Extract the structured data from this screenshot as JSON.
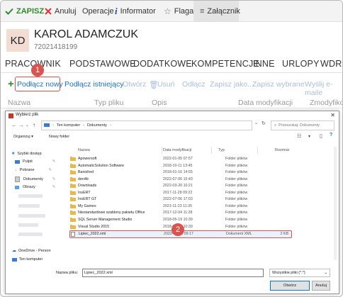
{
  "toolbar": {
    "save_label": "ZAPISZ",
    "cancel_label": "Anuluj",
    "operations_label": "Operacje",
    "informator_label": "Informator",
    "flag_label": "Flaga",
    "attachment_label": "Załącznik"
  },
  "header": {
    "initials": "KD",
    "name": "KAROL ADAMCZUK",
    "id": "72021418199"
  },
  "tabs": [
    "PRACOWNIK",
    "PODSTAWOWE",
    "DODATKOWE",
    "KOMPETENCJE",
    "INNE",
    "URLOPY",
    "WDRO"
  ],
  "actions": {
    "attach_new": "Podłącz nowy",
    "attach_existing": "Podłącz istniejący",
    "open": "Otwórz",
    "delete": "Usuń",
    "detach": "Odłącz",
    "save_as": "Zapisz jako...",
    "save_selected": "Zapisz wybrane",
    "send_email": "Wyślij e-maile"
  },
  "table_headers": [
    "Nazwa",
    "Typ pliku",
    "Opis",
    "Data modyfikacji",
    "Zmodyfikow"
  ],
  "badges": {
    "one": "1",
    "two": "2"
  },
  "dialog": {
    "title": "Wybierz plik",
    "close_label": "✕",
    "breadcrumb": [
      "Ten komputer",
      "Dokumenty"
    ],
    "search_placeholder": "Przeszukaj: Dokumenty",
    "organize_label": "Organizuj ▾",
    "new_folder_label": "Nowy folder",
    "sidebar": {
      "quick_access": "Szybki dostęp",
      "desktop": "Pulpit",
      "downloads": "Pobrane",
      "documents": "Dokumenty",
      "pictures": "Obrazy",
      "onedrive": "OneDrive - Person",
      "this_pc": "Ten komputer"
    },
    "columns": [
      "Nazwa",
      "Data modyfikacji",
      "Typ",
      "Rozmiar"
    ],
    "files": [
      {
        "name": "Apowersoft",
        "date": "2022-01-05 07:57",
        "type": "Folder plików",
        "size": ""
      },
      {
        "name": "AutomaticSolution Software",
        "date": "2018-10-11 13:45",
        "type": "Folder plików",
        "size": ""
      },
      {
        "name": "Banished",
        "date": "2018-01-16 14:55",
        "type": "Folder plików",
        "size": ""
      },
      {
        "name": "den4b",
        "date": "2022-07-06 15:43",
        "type": "Folder plików",
        "size": ""
      },
      {
        "name": "Downloads",
        "date": "2022-03-20 10:21",
        "type": "Folder plików",
        "size": ""
      },
      {
        "name": "InsERT",
        "date": "2017-11-28 09:22",
        "type": "Folder plików",
        "size": ""
      },
      {
        "name": "InsERT GT",
        "date": "2022-07-06 17:03",
        "type": "Folder plików",
        "size": ""
      },
      {
        "name": "My Games",
        "date": "2021-11-23 11:35",
        "type": "Folder plików",
        "size": ""
      },
      {
        "name": "Niestandardowe szablony pakietu Office",
        "date": "2017-12-04 11:28",
        "type": "Folder plików",
        "size": ""
      },
      {
        "name": "SQL Server Management Studio",
        "date": "2018-05-19 10:39",
        "type": "Folder plików",
        "size": ""
      },
      {
        "name": "Visual Studio 2015",
        "date": "2018-05-19 10:39",
        "type": "Folder plików",
        "size": ""
      },
      {
        "name": "Lipiec_2022.xml",
        "date": "2022-07-13 09:17",
        "type": "Dokument XML",
        "size": "2 KB"
      }
    ],
    "filename_label": "Nazwa pliku:",
    "filename_value": "Lipiec_2022.xml",
    "filetype_value": "Wszystkie pliki (*.*)",
    "open_button": "Otwórz",
    "cancel_button": "Anuluj"
  },
  "colors": {
    "accent": "#1a73c7",
    "highlight": "#d9534f",
    "save": "#2e8b2e",
    "folder": "#e8b84a"
  }
}
